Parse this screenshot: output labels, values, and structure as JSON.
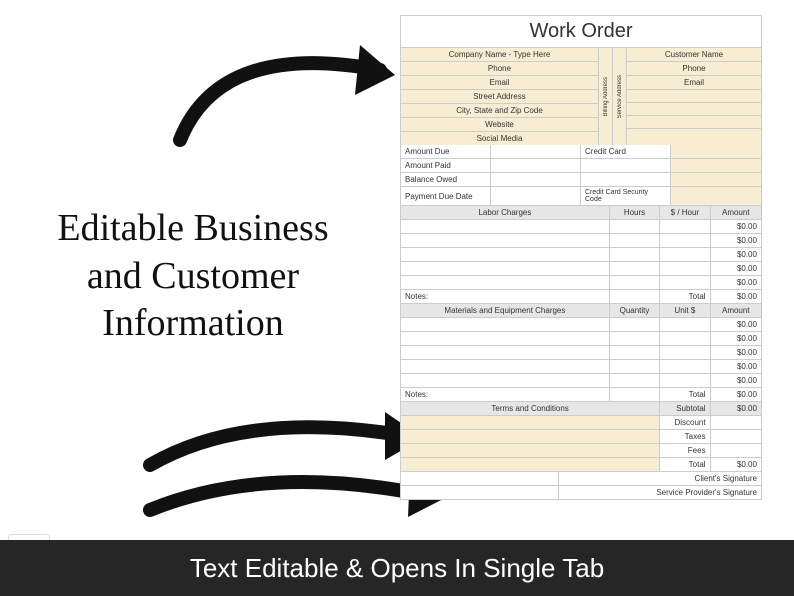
{
  "annotation": "Editable Business and Customer Information",
  "banner": "Text Editable  & Opens In Single Tab",
  "sheet": {
    "title": "Work Order",
    "company": {
      "name": "Company Name - Type Here",
      "phone": "Phone",
      "email": "Email",
      "street": "Street Address",
      "city": "City, State and Zip Code",
      "website": "Website",
      "social": "Social Media"
    },
    "customer": {
      "name": "Customer Name",
      "phone": "Phone",
      "email": "Email",
      "billing_label": "Billing Address",
      "service_label": "Service Address"
    },
    "payment": {
      "amount_due": "Amount Due",
      "amount_paid": "Amount Paid",
      "balance_owed": "Balance Owed",
      "due_date": "Payment Due Date",
      "cc1": "Credit Card",
      "cc_sec": "Credit Card Security Code"
    },
    "labor": {
      "header": "Labor Charges",
      "hours": "Hours",
      "rate": "$ / Hour",
      "amount": "Amount",
      "zero": "$0.00",
      "notes": "Notes:",
      "total": "Total"
    },
    "materials": {
      "header": "Materials and Equipment Charges",
      "qty": "Quantity",
      "unit": "Unit $",
      "amount": "Amount",
      "zero": "$0.00",
      "notes": "Notes:",
      "total": "Total"
    },
    "terms": {
      "header": "Terms and Conditions",
      "subtotal": "Subtotal",
      "discount": "Discount",
      "taxes": "Taxes",
      "fees": "Fees",
      "total": "Total",
      "zero": "$0.00"
    },
    "sig": {
      "client": "Client's Signature",
      "provider": "Service Provider's Signature"
    }
  }
}
